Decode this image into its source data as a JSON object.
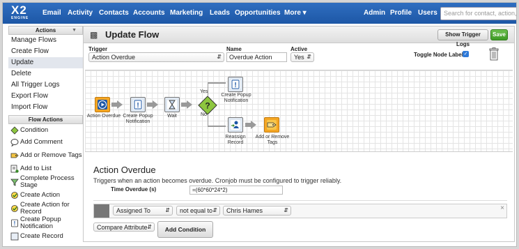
{
  "topbar": {
    "logo": "X2",
    "logo_sub": "ENGINE",
    "nav": [
      "Email",
      "Activity",
      "Contacts",
      "Accounts",
      "Marketing",
      "Leads",
      "Opportunities",
      "More ▾",
      "Admin",
      "Profile",
      "Users"
    ],
    "search_placeholder": "Search for contact, action, deal"
  },
  "sidebar": {
    "actions_header": "Actions",
    "items": [
      "Manage Flows",
      "Create Flow",
      "Update",
      "Delete",
      "All Trigger Logs",
      "Export Flow",
      "Import Flow"
    ],
    "active_index": 2,
    "flow_actions_header": "Flow Actions",
    "flow_actions": [
      "Condition",
      "Add Comment",
      "Add or Remove Tags",
      "Add to List",
      "Complete Process Stage",
      "Create Action",
      "Create Action for Record",
      "Create Popup Notification",
      "Create Record"
    ]
  },
  "header": {
    "title": "Update Flow",
    "show_trigger_logs": "Show Trigger Logs",
    "save": "Save"
  },
  "form": {
    "trigger_label": "Trigger",
    "trigger_value": "Action Overdue",
    "name_label": "Name",
    "name_value": "Overdue Action",
    "active_label": "Active",
    "active_value": "Yes",
    "toggle_label": "Toggle Node Labels",
    "toggle_checked": true
  },
  "flow": {
    "nodes": {
      "trigger": "Action Overdue",
      "popup1": "Create Popup Notification",
      "wait": "Wait",
      "popup2": "Create Popup Notification",
      "reassign": "Reassign Record",
      "tags": "Add or Remove Tags"
    },
    "yes": "Yes",
    "no": "No"
  },
  "details": {
    "title": "Action Overdue",
    "description": "Triggers when an action becomes overdue. Cronjob must be configured to trigger reliably.",
    "time_label": "Time Overdue (s)",
    "time_value": "=(60*60*24*2)",
    "condition": {
      "attribute": "Assigned To",
      "operator": "not equal to",
      "value": "Chris Hames"
    },
    "compare": "Compare Attribute",
    "add_condition": "Add Condition"
  },
  "colors": {
    "topbar": "#1d57a6",
    "save": "#3e9a26",
    "decision": "#8dc63f"
  }
}
